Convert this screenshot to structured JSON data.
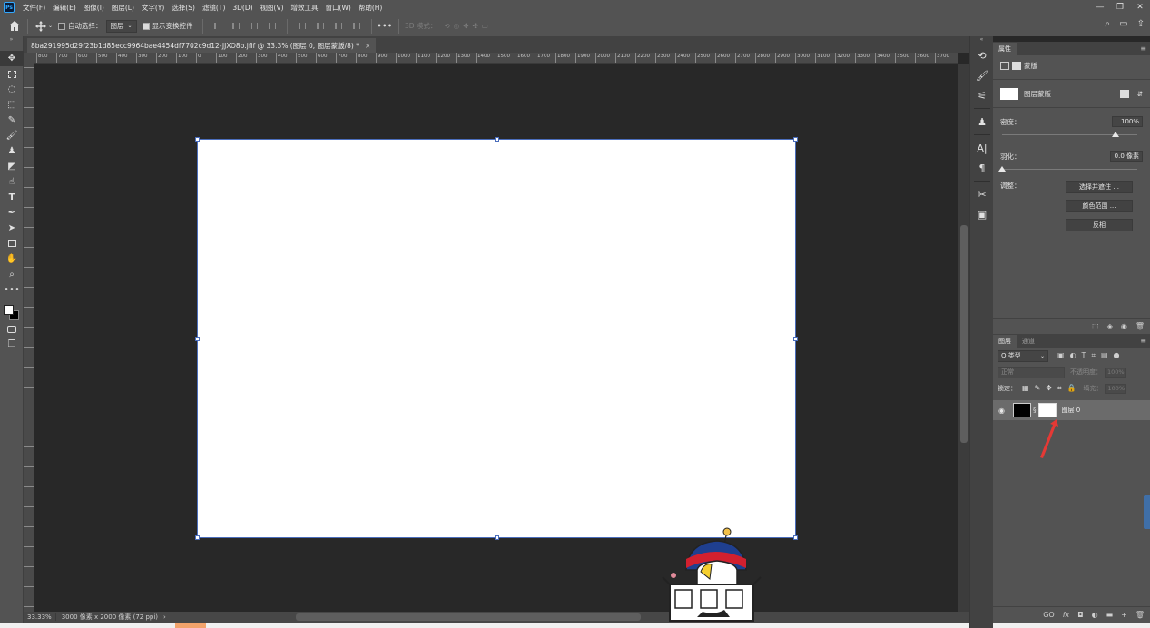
{
  "app": {
    "logo": "Ps"
  },
  "menu": [
    "文件(F)",
    "编辑(E)",
    "图像(I)",
    "图层(L)",
    "文字(Y)",
    "选择(S)",
    "滤镜(T)",
    "3D(D)",
    "视图(V)",
    "增效工具",
    "窗口(W)",
    "帮助(H)"
  ],
  "window_controls": {
    "minimize": "—",
    "restore": "❐",
    "close": "✕"
  },
  "options": {
    "auto_select_label": "自动选择：",
    "auto_select_target": "图层",
    "show_transform_label": "显示变换控件",
    "more_label": "•••",
    "mode_3d_label": "3D 模式："
  },
  "document": {
    "tab_title": "8ba291995d29f23b1d85ecc9964bae4454df7702c9d12-JJXO8b.jfif @ 33.3% (图层 0, 图层蒙版/8) *",
    "tab_close": "×",
    "canvas_color": "#ffffff"
  },
  "ruler": {
    "top_labels": [
      "800",
      "700",
      "600",
      "500",
      "400",
      "300",
      "200",
      "100",
      "0",
      "100",
      "200",
      "300",
      "400",
      "500",
      "600",
      "700",
      "800",
      "900",
      "1000",
      "1100",
      "1200",
      "1300",
      "1400",
      "1500",
      "1600",
      "1700",
      "1800",
      "1900",
      "2000",
      "2100",
      "2200",
      "2300",
      "2400",
      "2500",
      "2600",
      "2700",
      "2800",
      "2900",
      "3000",
      "3100",
      "3200",
      "3300",
      "3400",
      "3500",
      "3600",
      "3700"
    ]
  },
  "status": {
    "zoom": "33.33%",
    "info": "3000 像素 x 2000 像素 (72 ppi)",
    "arrow": "›"
  },
  "properties_panel": {
    "tab": "属性",
    "section_label": "蒙版",
    "mask_type_label": "图层蒙版",
    "density_label": "密度：",
    "density_value": "100%",
    "feather_label": "羽化：",
    "feather_value": "0.0 像素",
    "adjust_label": "调整：",
    "btn_select_mask": "选择并遮住 ...",
    "btn_color_range": "颜色范围 ...",
    "btn_invert": "反相",
    "density_level": 1.0,
    "feather_level": 0.0
  },
  "layers_panel": {
    "tabs": [
      "图层",
      "通道"
    ],
    "filter_label": "Q 类型",
    "blend_mode": "正常",
    "opacity_label": "不透明度：",
    "opacity_value": "100%",
    "lock_label": "锁定：",
    "fill_label": "填充：",
    "fill_value": "100%",
    "layer_name": "图层 0",
    "footer_icons": [
      "GO",
      "fx",
      "◘",
      "◐",
      "▬",
      "+",
      "🗑"
    ]
  },
  "colors": {
    "selection_blue": "#4b6ebc",
    "foreground": "#ffffff",
    "background": "#000000",
    "annotation_arrow": "#e53935"
  }
}
